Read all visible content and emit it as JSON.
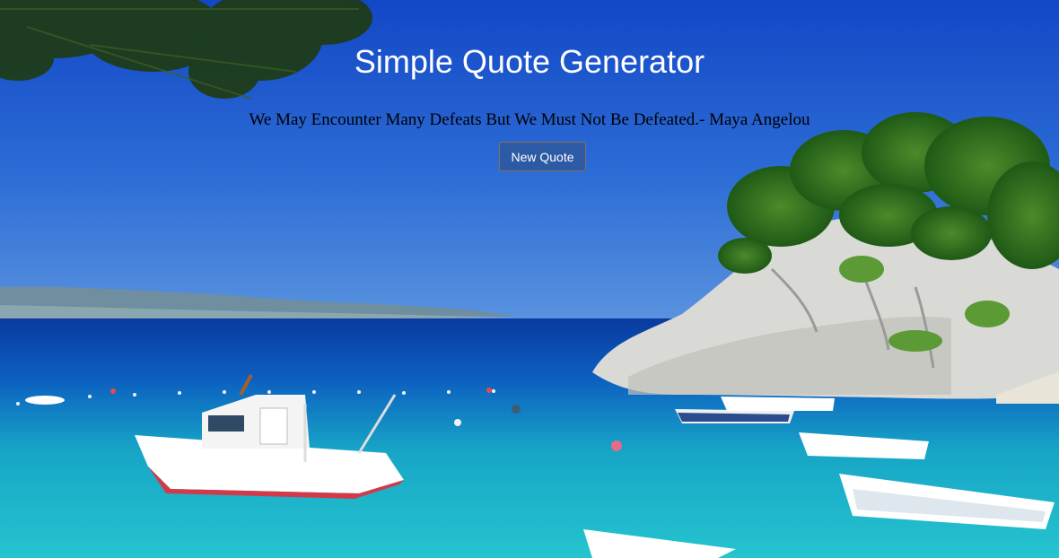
{
  "header": {
    "title": "Simple Quote Generator"
  },
  "quote": {
    "text": "We May Encounter Many Defeats But We Must Not Be Defeated.- Maya Angelou"
  },
  "controls": {
    "new_quote_label": "New Quote"
  },
  "colors": {
    "sky": "#1a56c8",
    "sea_deep": "#0a3fa0",
    "sea_turquoise": "#1fb3c8",
    "button": "#2d5aa5"
  }
}
